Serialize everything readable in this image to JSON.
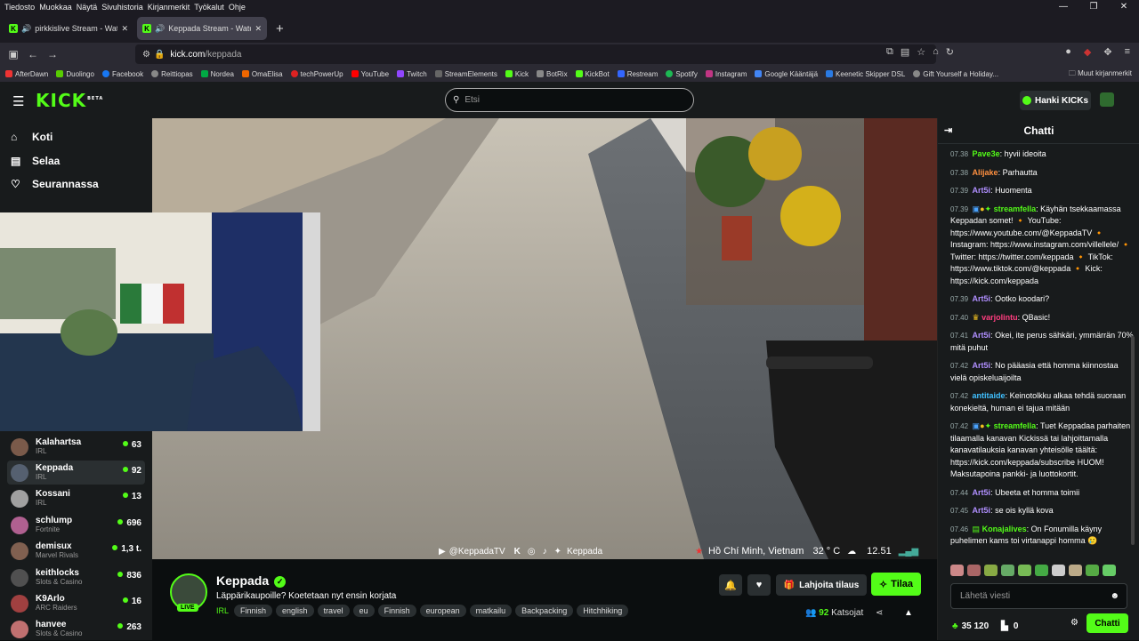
{
  "menubar": {
    "items": [
      "Tiedosto",
      "Muokkaa",
      "Näytä",
      "Sivuhistoria",
      "Kirjanmerkit",
      "Työkalut",
      "Ohje"
    ]
  },
  "tabs": [
    {
      "title": "pirkkislive Stream - Watch L",
      "active": false
    },
    {
      "title": "Keppada Stream - Watch L",
      "active": true
    }
  ],
  "urlbar": {
    "host": "kick.com",
    "path": "/keppada"
  },
  "bookmarks": [
    "AfterDawn",
    "Duolingo",
    "Facebook",
    "Reittiopas",
    "Nordea",
    "OmaElisa",
    "techPowerUp",
    "YouTube",
    "Twitch",
    "StreamElements",
    "Kick",
    "BotRix",
    "KickBot",
    "Restream",
    "Spotify",
    "Instagram",
    "Google Kääntäjä",
    "Keenetic Skipper DSL",
    "Gift Yourself a Holiday..."
  ],
  "bookmark_colors": [
    "#e33",
    "#58cc02",
    "#1877f2",
    "#888",
    "#0a4",
    "#e60",
    "#d22",
    "#f00",
    "#9146ff",
    "#333",
    "#53fc18",
    "#888",
    "#53fc18",
    "#36f",
    "#1db954",
    "#c13584",
    "#4285f4",
    "#2a7ae2",
    "#888"
  ],
  "bookmarks_other": "Muut kirjanmerkit",
  "header": {
    "logo": "KICK",
    "logo_sup": "BETA",
    "search_placeholder": "Etsi",
    "get_kicks": "Hanki KICKs"
  },
  "nav": [
    {
      "label": "Koti",
      "icon": "home-icon"
    },
    {
      "label": "Selaa",
      "icon": "browse-icon"
    },
    {
      "label": "Seurannassa",
      "icon": "heart-icon"
    }
  ],
  "channels": [
    {
      "name": "Kalahartsa",
      "category": "IRL",
      "viewers": "63",
      "color": "#7a5a4a"
    },
    {
      "name": "Keppada",
      "category": "IRL",
      "viewers": "92",
      "color": "#556070",
      "selected": true
    },
    {
      "name": "Kossani",
      "category": "IRL",
      "viewers": "13",
      "color": "#a0a0a0"
    },
    {
      "name": "schlump",
      "category": "Fortnite",
      "viewers": "696",
      "color": "#b06090"
    },
    {
      "name": "demisux",
      "category": "Marvel Rivals",
      "viewers": "1,3 t.",
      "color": "#806050"
    },
    {
      "name": "keithlocks",
      "category": "Slots & Casino",
      "viewers": "836",
      "color": "#505050"
    },
    {
      "name": "K9Arlo",
      "category": "ARC Raiders",
      "viewers": "16",
      "color": "#a04040"
    },
    {
      "name": "hanvee",
      "category": "Slots & Casino",
      "viewers": "263",
      "color": "#c07070"
    }
  ],
  "overlay": {
    "handle": "@KeppadaTV",
    "brand": "Keppada",
    "location": "Hồ Chí Minh, Vietnam",
    "temp": "32 ° C",
    "time": "12.51"
  },
  "stream": {
    "channel": "Keppada",
    "title": "Läppärikaupoille? Koetetaan nyt ensin korjata",
    "category": "IRL",
    "tags": [
      "Finnish",
      "english",
      "travel",
      "eu",
      "Finnish",
      "european",
      "matkailu",
      "Backpacking",
      "Hitchhiking"
    ],
    "live": "LIVE",
    "gift_label": "Lahjoita tilaus",
    "subscribe_label": "Tilaa",
    "viewers": "92",
    "viewers_label": "Katsojat"
  },
  "chat": {
    "title": "Chatti",
    "messages": [
      {
        "time": "07.38",
        "user": "Pave3e",
        "color": "#53fc18",
        "text": "hyvii ideoita"
      },
      {
        "time": "07.38",
        "user": "Alijake",
        "color": "#ff9040",
        "text": "Parhautta"
      },
      {
        "time": "07.39",
        "user": "Art5i",
        "color": "#b08fff",
        "text": "Huomenta"
      },
      {
        "time": "07.39",
        "user": "streamfella",
        "color": "#53fc18",
        "text": "Käyhän tsekkaamassa Keppadan somet! 🔸 YouTube: https://www.youtube.com/@KeppadaTV 🔸 Instagram: https://www.instagram.com/villellele/ 🔸 Twitter: https://twitter.com/keppada 🔸 TikTok: https://www.tiktok.com/@keppada 🔸 Kick: https://kick.com/keppada"
      },
      {
        "time": "07.39",
        "user": "Art5i",
        "color": "#b08fff",
        "text": "Ootko koodari?"
      },
      {
        "time": "07.40",
        "user": "varjolintu",
        "color": "#ff3d7f",
        "text": "QBasic!"
      },
      {
        "time": "07.41",
        "user": "Art5i",
        "color": "#b08fff",
        "text": "Okei, ite perus sähkäri, ymmärrän 70% mitä puhut"
      },
      {
        "time": "07.42",
        "user": "Art5i",
        "color": "#b08fff",
        "text": "No pääasia että homma kiinnostaa vielä opiskeluaijoilta"
      },
      {
        "time": "07.42",
        "user": "antitaide",
        "color": "#40c0ff",
        "text": "Keinotolkku alkaa tehdä suoraan konekieltä, human ei tajua mitään"
      },
      {
        "time": "07.42",
        "user": "streamfella",
        "color": "#53fc18",
        "text": "Tuet Keppadaa parhaiten tilaamalla kanavan Kickissä tai lahjoittamalla kanavatilauksia kanavan yhteisölle täältä: https://kick.com/keppada/subscribe HUOM! Maksutapoina pankki- ja luottokortit."
      },
      {
        "time": "07.44",
        "user": "Art5i",
        "color": "#b08fff",
        "text": "Ubeeta et homma toimii"
      },
      {
        "time": "07.45",
        "user": "Art5i",
        "color": "#b08fff",
        "text": "se ois kyllä kova"
      },
      {
        "time": "07.46",
        "user": "Konajalives",
        "color": "#53fc18",
        "text": "On Fonumilla käyny puhelimen kams toi virtanappi homma 🥲"
      }
    ],
    "input_placeholder": "Lähetä viesti",
    "points": "35 120",
    "points2": "0",
    "chat_button": "Chatti"
  }
}
